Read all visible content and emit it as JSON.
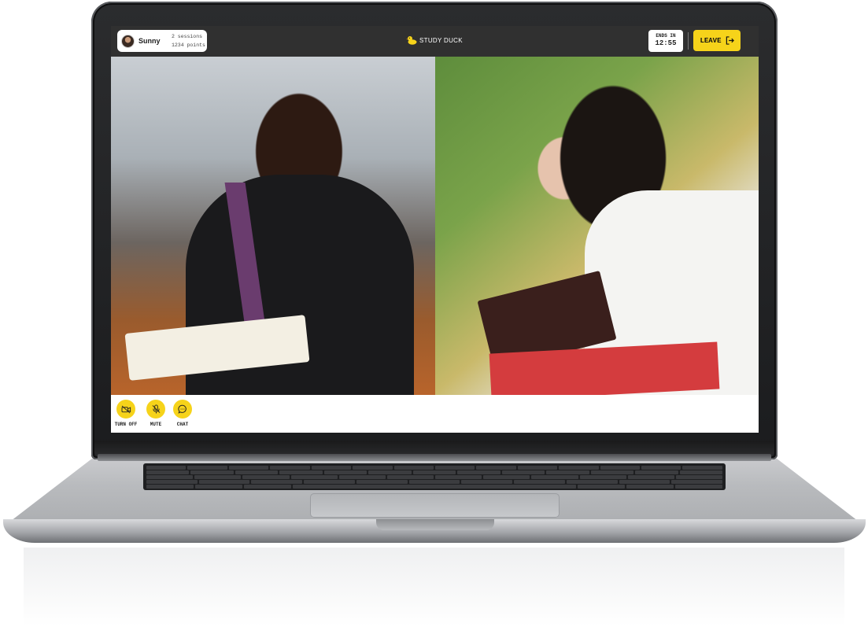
{
  "header": {
    "user": {
      "name": "Sunny",
      "sessions": "2 sessions",
      "points": "1234 points"
    },
    "brand": "STUDY DUCK",
    "timer": {
      "label": "ENDS IN",
      "value": "12:55"
    },
    "leave_label": "LEAVE"
  },
  "controls": [
    {
      "label": "TURN OFF",
      "icon": "camera-off-icon"
    },
    {
      "label": "MUTE",
      "icon": "mic-off-icon"
    },
    {
      "label": "CHAT",
      "icon": "chat-icon"
    }
  ],
  "colors": {
    "accent": "#f6d31a",
    "topbar": "#303030"
  }
}
